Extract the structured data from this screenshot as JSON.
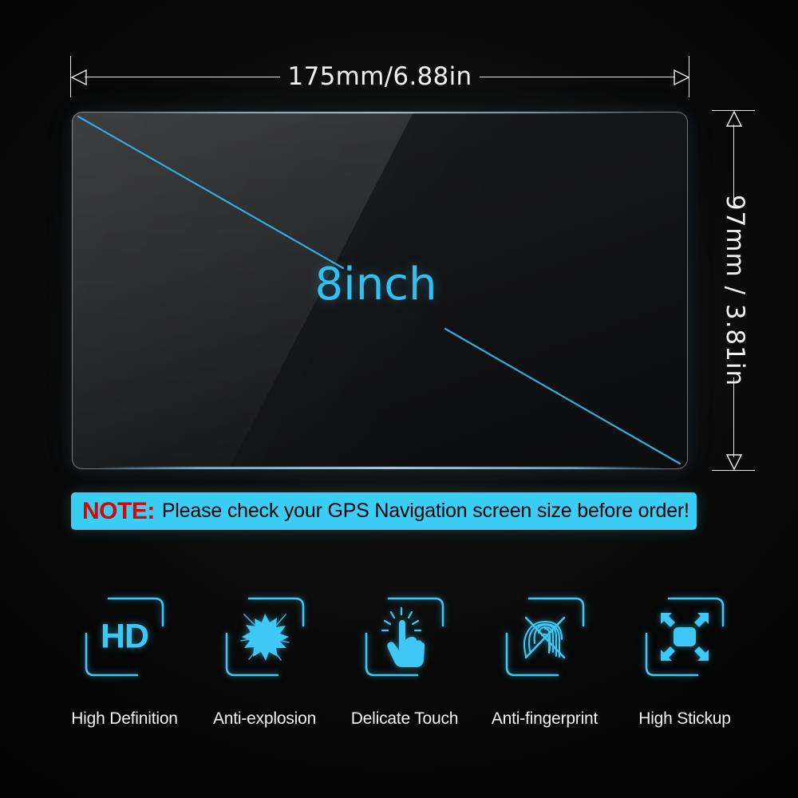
{
  "product": {
    "panel_label": "8inch",
    "width_dimension": "175mm/6.88in",
    "height_dimension": "97mm / 3.81in"
  },
  "note": {
    "prefix": "NOTE:",
    "message": "Please check your GPS Navigation screen size before order!"
  },
  "features": [
    {
      "icon": "hd-icon",
      "glyph_text": "HD",
      "label": "High Definition"
    },
    {
      "icon": "explosion-icon",
      "glyph_text": "",
      "label": "Anti-explosion"
    },
    {
      "icon": "touch-hand-icon",
      "glyph_text": "",
      "label": "Delicate Touch"
    },
    {
      "icon": "fingerprint-no-icon",
      "glyph_text": "",
      "label": "Anti-fingerprint"
    },
    {
      "icon": "expand-arrows-icon",
      "glyph_text": "",
      "label": "High Stickup"
    }
  ],
  "colors": {
    "accent_cyan": "#3FC8F5",
    "note_background": "#3CCDF5",
    "note_prefix": "#CF0A0A",
    "background": "#0A0A0A",
    "dimension_line": "#E8E8E8"
  }
}
